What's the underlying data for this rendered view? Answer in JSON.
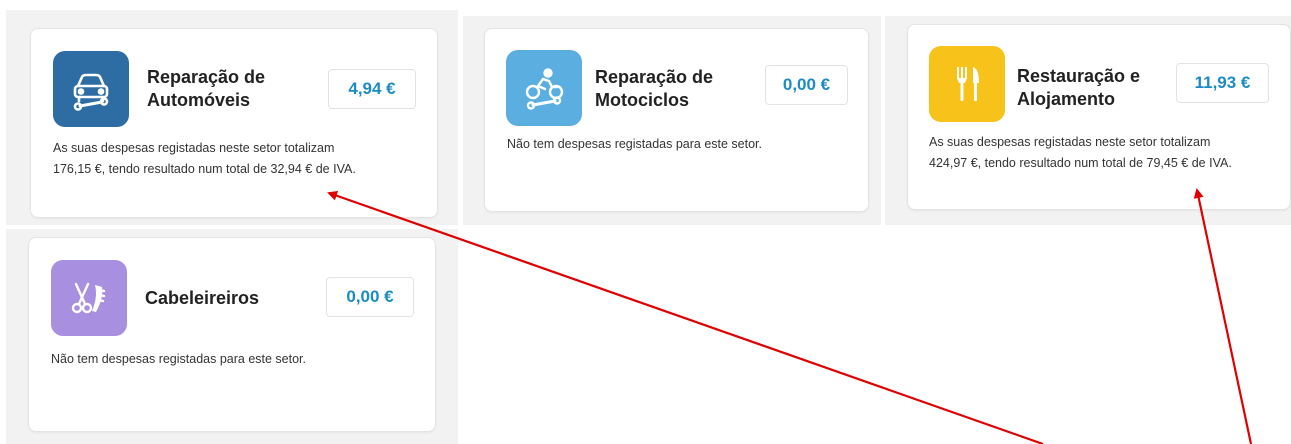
{
  "colors": {
    "accent_amount": "#1a8cc3",
    "auto_icon_bg": "#2e6da4",
    "moto_icon_bg": "#5aaee0",
    "food_icon_bg": "#f7c21a",
    "hair_icon_bg": "#a98fe0",
    "annotation_arrow": "#e00000"
  },
  "sectors": [
    {
      "title": "Reparação de\nAutomóveis",
      "amount": "4,94 €",
      "icon": "car-wrench-icon",
      "desc_parts": [
        "As suas despesas registadas neste setor totalizam",
        "176,15 €, tendo resultado num total de ",
        "32,94 €",
        " de IVA."
      ]
    },
    {
      "title": "Reparação de\nMotociclos",
      "amount": "0,00 €",
      "icon": "motorcycle-wrench-icon",
      "desc": "Não tem despesas registadas para este setor."
    },
    {
      "title": "Restauração e\nAlojamento",
      "amount": "11,93 €",
      "icon": "fork-knife-icon",
      "desc_parts": [
        "As suas despesas registadas neste setor totalizam",
        "424,97 €, tendo resultado num total de ",
        "79,45 €",
        " de IVA."
      ]
    },
    {
      "title": "Cabeleireiros",
      "amount": "0,00 €",
      "icon": "scissors-comb-icon",
      "desc": "Não tem despesas registadas para este setor."
    }
  ]
}
